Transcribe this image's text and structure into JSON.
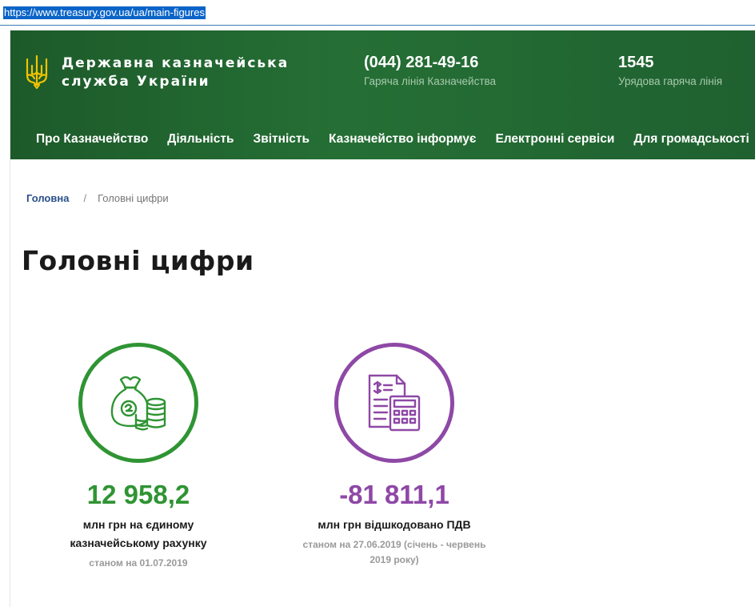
{
  "browser": {
    "url": "https://www.treasury.gov.ua/ua/main-figures"
  },
  "header": {
    "org_name": "Державна казначейська служба України",
    "hotline": {
      "number": "(044) 281-49-16",
      "label": "Гаряча лінія Казначейства"
    },
    "gov_hotline": {
      "number": "1545",
      "label": "Урядова гаряча лінія"
    },
    "nav": [
      "Про Казначейство",
      "Діяльність",
      "Звітність",
      "Казначейство інформує",
      "Електронні сервіси",
      "Для громадськості"
    ]
  },
  "breadcrumb": {
    "home": "Головна",
    "separator": "/",
    "current": "Головні цифри"
  },
  "page_title": "Головні цифри",
  "stats": [
    {
      "icon": "money-bag-coins-icon",
      "color": "#2f9433",
      "value": "12 958,2",
      "description": "млн грн на єдиному казначейському рахунку",
      "note": "станом на 01.07.2019"
    },
    {
      "icon": "invoice-calculator-icon",
      "color": "#8e48a6",
      "value": "-81 811,1",
      "description": "млн грн відшкодовано ПДВ",
      "note": "станом на 27.06.2019 (січень - червень 2019 року)"
    }
  ],
  "colors": {
    "header_green": "#256f35",
    "brand_green": "#2f9433",
    "brand_purple": "#8e48a6",
    "link_blue": "#2b4f8a"
  }
}
